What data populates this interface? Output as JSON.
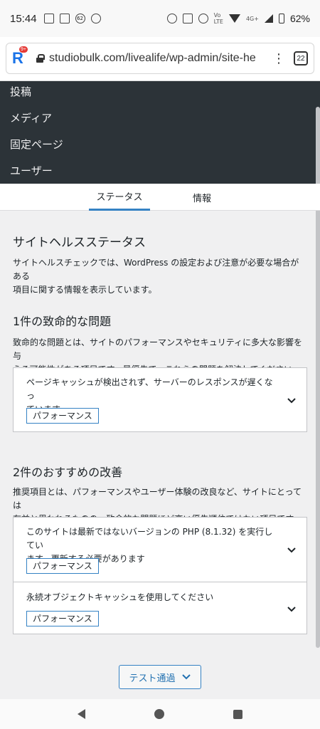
{
  "status_bar": {
    "time": "15:44",
    "notif_count": "62",
    "network_label": "4G+",
    "battery": "62%"
  },
  "browser": {
    "url": "studiobulk.com/livealife/wp-admin/site-healt",
    "logo_letter": "R",
    "logo_badge": "9+",
    "tabs_count": "22",
    "menu_glyph": "⋮"
  },
  "admin_menu": {
    "items": [
      "投稿",
      "メディア",
      "固定ページ",
      "ユーザー"
    ]
  },
  "tabs": [
    {
      "label": "ステータス",
      "active": true
    },
    {
      "label": "情報",
      "active": false
    }
  ],
  "page": {
    "title": "サイトヘルスステータス",
    "intro_l1": "サイトヘルスチェックでは、WordPress の設定および注意が必要な場合がある",
    "intro_l2": "項目に関する情報を表示しています。"
  },
  "critical": {
    "heading": "1件の致命的な問題",
    "desc_l1": "致命的な問題とは、サイトのパフォーマンスやセキュリティに多大な影響を与",
    "desc_l2": "える可能性がある項目です。最優先で、これらの問題を解決してください。",
    "items": [
      {
        "title_l1": "ページキャッシュが検出されず、サーバーのレスポンスが遅くなっ",
        "title_l2": "ています",
        "tag": "パフォーマンス"
      }
    ]
  },
  "recommended": {
    "heading": "2件のおすすめの改善",
    "desc_l1": "推奨項目とは、パフォーマンスやユーザー体験の改良など、サイトにとっては",
    "desc_l2": "有益と思われるものの、致命的な問題ほど高い優先順位ではない項目です。",
    "items": [
      {
        "title_l1": "このサイトは最新ではないバージョンの PHP (8.1.32) を実行してい",
        "title_l2": "ます。更新する必要があります",
        "tag": "パフォーマンス"
      },
      {
        "title_l1": "永続オブジェクトキャッシュを使用してください",
        "title_l2": "",
        "tag": "パフォーマンス"
      }
    ]
  },
  "passed_button": {
    "label": "テスト通過"
  },
  "icons": {
    "chevron": "chevron-down-icon",
    "lock": "lock-icon",
    "back": "back-icon",
    "home": "home-icon",
    "recents": "recents-icon"
  },
  "colors": {
    "admin_bg": "#2c3338",
    "accent": "#3582c4",
    "link": "#2271b1",
    "page_bg": "#f0f0f1"
  }
}
